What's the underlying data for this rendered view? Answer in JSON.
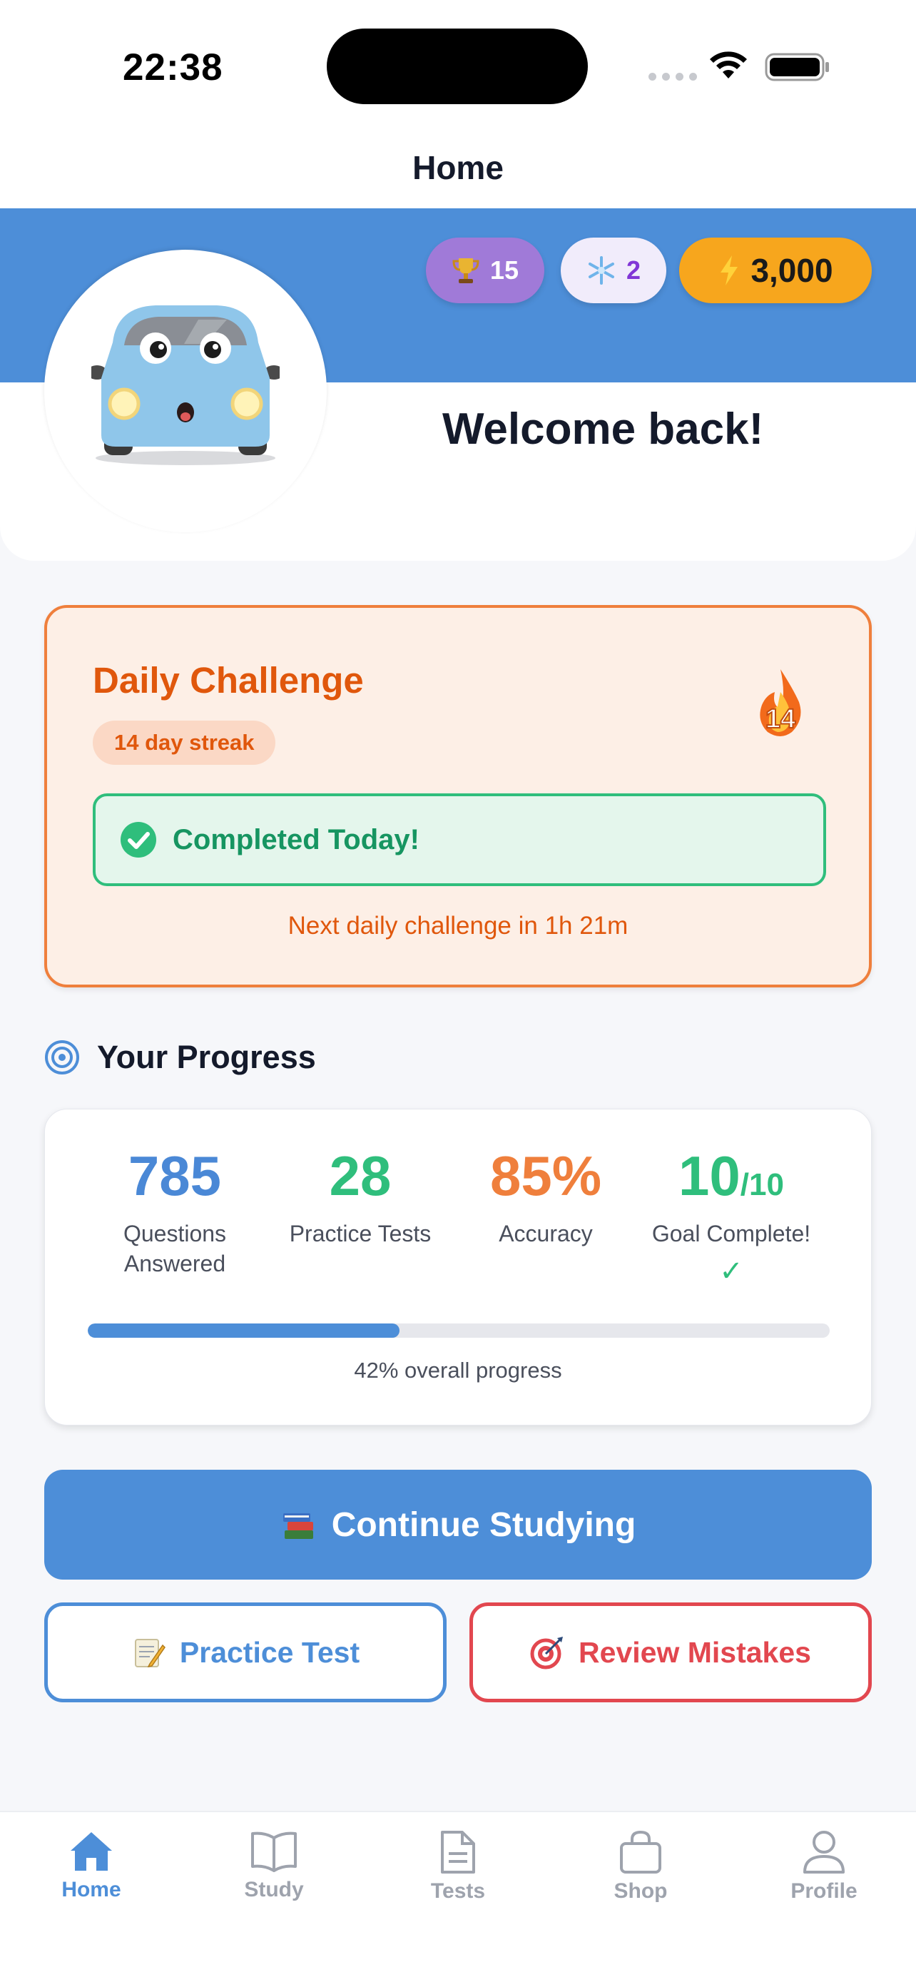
{
  "status_bar": {
    "time": "22:38"
  },
  "header": {
    "title": "Home"
  },
  "stats_bar": {
    "trophies": "15",
    "freezes": "2",
    "energy": "3,000"
  },
  "hero": {
    "welcome": "Welcome back!"
  },
  "daily_challenge": {
    "title": "Daily Challenge",
    "streak": "14 day streak",
    "flame_count": "14",
    "status": "Completed Today!",
    "next": "Next daily challenge in 1h 21m"
  },
  "progress": {
    "heading": "Your Progress",
    "stats": [
      {
        "value": "785",
        "label": "Questions Answered",
        "color": "#4a88d6"
      },
      {
        "value": "28",
        "label": "Practice Tests",
        "color": "#2fbe7c"
      },
      {
        "value": "85%",
        "label": "Accuracy",
        "color": "#ef7f3c"
      },
      {
        "value": "10",
        "value_sub": "/10",
        "label": "Goal Complete!",
        "check": "✓",
        "color": "#2fbe7c"
      }
    ],
    "overall_percent": 42,
    "caption": "42% overall progress"
  },
  "actions": {
    "continue": "Continue Studying",
    "practice": "Practice Test",
    "review": "Review Mistakes"
  },
  "tabs": [
    {
      "label": "Home",
      "icon": "home-icon",
      "active": true
    },
    {
      "label": "Study",
      "icon": "book-icon",
      "active": false
    },
    {
      "label": "Tests",
      "icon": "document-icon",
      "active": false
    },
    {
      "label": "Shop",
      "icon": "bag-icon",
      "active": false
    },
    {
      "label": "Profile",
      "icon": "person-icon",
      "active": false
    }
  ],
  "colors": {
    "primary": "#4d8ed8",
    "orange": "#ef7f3c",
    "green": "#2fbe7c",
    "red": "#e2474f"
  }
}
